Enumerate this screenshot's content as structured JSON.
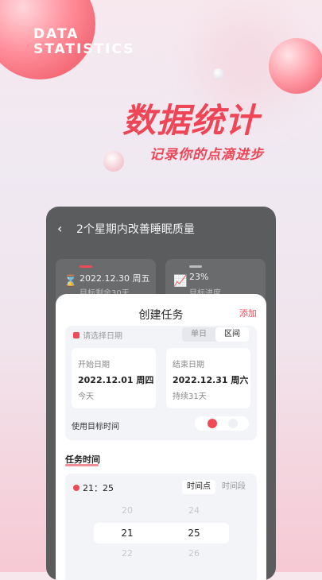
{
  "hero": {
    "en_line1": "DATA",
    "en_line2": "STATISTICS",
    "cn_title": "数据统计",
    "cn_subtitle": "记录你的点滴进步"
  },
  "screen": {
    "back_icon": "chevron-left-icon",
    "title": "2个星期内改善睡眠质量",
    "stats": [
      {
        "icon": "hourglass-icon",
        "value": "2022.12.30 周五",
        "sub": "目标剩余30天",
        "accent": "#ef4b57"
      },
      {
        "icon": "chart-icon",
        "value": "23%",
        "sub": "目标进度",
        "accent": "#bdbdbd"
      }
    ]
  },
  "sheet": {
    "title": "创建任务",
    "add_label": "添加",
    "date_hint": "请选择日期",
    "date_modes": [
      "单日",
      "区间"
    ],
    "start": {
      "label": "开始日期",
      "value": "2022.12.01 周四",
      "note": "今天"
    },
    "end": {
      "label": "结束日期",
      "value": "2022.12.31 周六",
      "note": "持续31天"
    },
    "use_target_label": "使用目标时间",
    "task_time_label": "任务时间",
    "time_value": "21：25",
    "time_modes": [
      "时间点",
      "时间段"
    ],
    "picker": {
      "hours": [
        "20",
        "21",
        "22"
      ],
      "minutes": [
        "24",
        "25",
        "26"
      ]
    }
  }
}
